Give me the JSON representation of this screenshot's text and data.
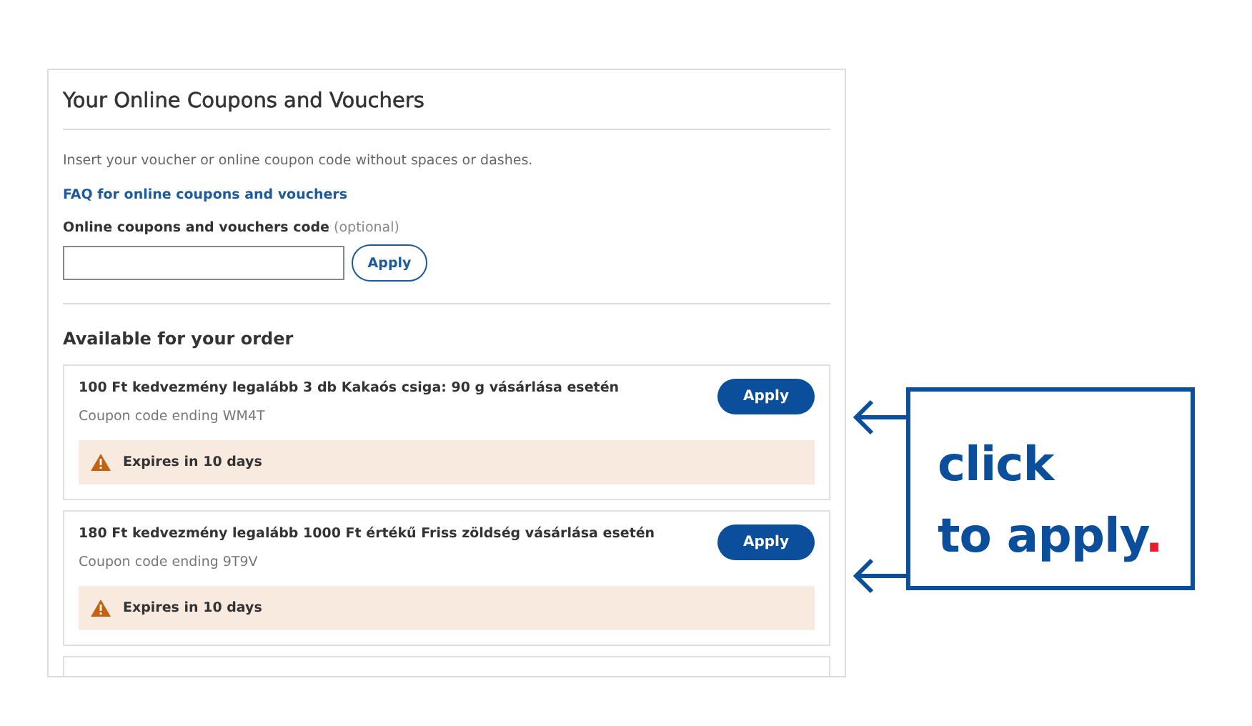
{
  "panel": {
    "title": "Your Online Coupons and Vouchers",
    "instruction": "Insert your voucher or online coupon code without spaces or dashes.",
    "faq_link": "FAQ for online coupons and vouchers",
    "field_label": "Online coupons and vouchers code",
    "field_hint": "(optional)",
    "apply_button": "Apply"
  },
  "available": {
    "heading": "Available for your order",
    "coupons": [
      {
        "title": "100 Ft kedvezmény legalább 3 db Kakaós csiga: 90 g vásárlása esetén",
        "code": "Coupon code ending WM4T",
        "button": "Apply",
        "expiry": "Expires in 10 days"
      },
      {
        "title": "180 Ft kedvezmény legalább 1000 Ft értékű Friss zöldség vásárlása esetén",
        "code": "Coupon code ending 9T9V",
        "button": "Apply",
        "expiry": "Expires in 10 days"
      }
    ]
  },
  "callout": {
    "lines": [
      "click",
      "to apply"
    ],
    "end_mark": "."
  }
}
